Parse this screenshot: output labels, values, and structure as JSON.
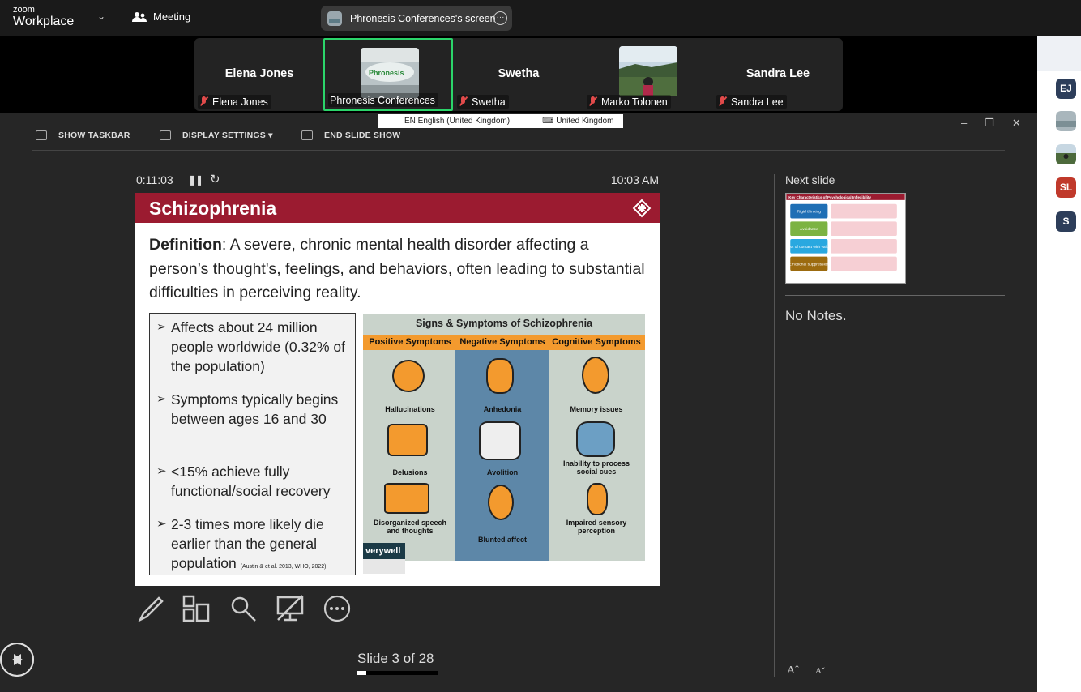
{
  "topbar": {
    "logo_small": "zoom",
    "logo_big": "Workplace",
    "meeting_label": "Meeting",
    "screen_share_label": "Phronesis Conferences's screen"
  },
  "participants": [
    {
      "display_name": "Elena Jones",
      "label": "Elena Jones",
      "muted": true,
      "video": false
    },
    {
      "display_name": "",
      "label": "Phronesis Conferences",
      "muted": false,
      "video": true,
      "active": true
    },
    {
      "display_name": "Swetha",
      "label": "Swetha",
      "muted": true,
      "video": false
    },
    {
      "display_name": "",
      "label": "Marko Tolonen",
      "muted": true,
      "video": true
    },
    {
      "display_name": "Sandra Lee",
      "label": "Sandra Lee",
      "muted": true,
      "video": false
    }
  ],
  "sidebar_avatars": [
    {
      "initials": "EJ",
      "color": "#2d3e5a"
    },
    {
      "initials": "",
      "color": "#8a9aa6"
    },
    {
      "initials": "",
      "color": "#4d6a3c"
    },
    {
      "initials": "SL",
      "color": "#c0392b"
    },
    {
      "initials": "S",
      "color": "#2d3e5a"
    }
  ],
  "language_bar": {
    "language": "EN English (United Kingdom)",
    "keyboard": "United Kingdom"
  },
  "toolbar": {
    "show_taskbar": "SHOW TASKBAR",
    "display_settings": "DISPLAY SETTINGS ▾",
    "end_slide_show": "END SLIDE SHOW"
  },
  "presenter": {
    "timer": "0:11:03",
    "clock": "10:03 AM",
    "slide_counter": "Slide 3 of 28",
    "progress": 0.107,
    "next_slide_label": "Next slide",
    "notes": "No Notes."
  },
  "slide": {
    "title": "Schizophrenia",
    "definition_term": "Definition",
    "definition_text": ": A severe, chronic mental health disorder affecting a person’s thought's, feelings, and behaviors, often leading to substantial difficulties in perceiving reality.",
    "bullets": [
      "Affects about 24 million people worldwide (0.32% of the population)",
      "Symptoms typically begins between ages 16 and 30",
      "<15% achieve fully functional/social recovery",
      "2-3 times more likely die earlier than the general population"
    ],
    "citation": "(Austin & et al. 2013, WHO, 2022)",
    "infographic": {
      "title": "Signs & Symptoms of Schizophrenia",
      "columns": [
        "Positive Symptoms",
        "Negative Symptoms",
        "Cognitive Symptoms"
      ],
      "positive": [
        "Hallucinations",
        "Delusions",
        "Disorganized speech and thoughts"
      ],
      "negative": [
        "Anhedonia",
        "Avolition",
        "Blunted affect"
      ],
      "cognitive": [
        "Memory issues",
        "Inability to process social cues",
        "Impaired sensory perception"
      ],
      "brand": "verywell"
    }
  },
  "next_slide": {
    "title": "Key Characteristics of Psychological Inflexibility",
    "rows": [
      {
        "label": "Rigid thinking",
        "color": "#1f6fb5"
      },
      {
        "label": "Avoidance",
        "color": "#7cb342"
      },
      {
        "label": "Loss of contact with values",
        "color": "#29a8e0"
      },
      {
        "label": "Emotional suppression",
        "color": "#9c6b0f"
      }
    ]
  }
}
